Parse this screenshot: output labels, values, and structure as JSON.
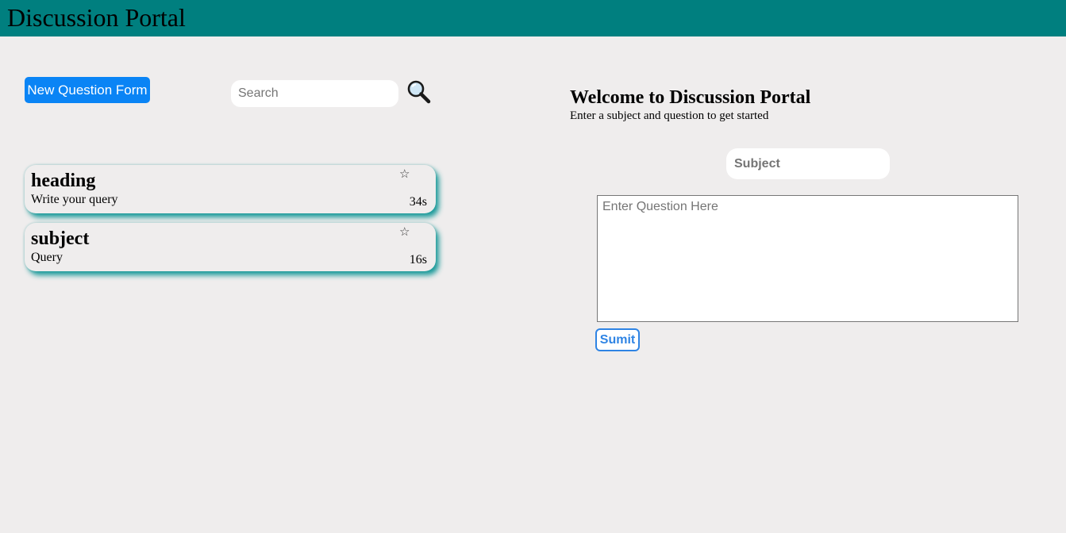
{
  "header": {
    "title": "Discussion Portal",
    "background": "#007f7f"
  },
  "toolbar": {
    "new_question_label": "New Question Form",
    "search_placeholder": "Search",
    "search_icon": "magnifying-glass-icon"
  },
  "questions": [
    {
      "title": "heading",
      "body": "Write your query",
      "star": "☆",
      "time": "34s"
    },
    {
      "title": "subject",
      "body": "Query",
      "star": "☆",
      "time": "16s"
    }
  ],
  "welcome": {
    "title": "Welcome to Discussion Portal",
    "subtitle": "Enter a subject and question to get started"
  },
  "form": {
    "subject_placeholder": "Subject",
    "question_placeholder": "Enter Question Here",
    "submit_label": "Sumit"
  },
  "colors": {
    "accent": "#0a84f5",
    "submit": "#2f84e4",
    "page_bg": "#efeded",
    "card_shadow": "#1a9a9a"
  }
}
